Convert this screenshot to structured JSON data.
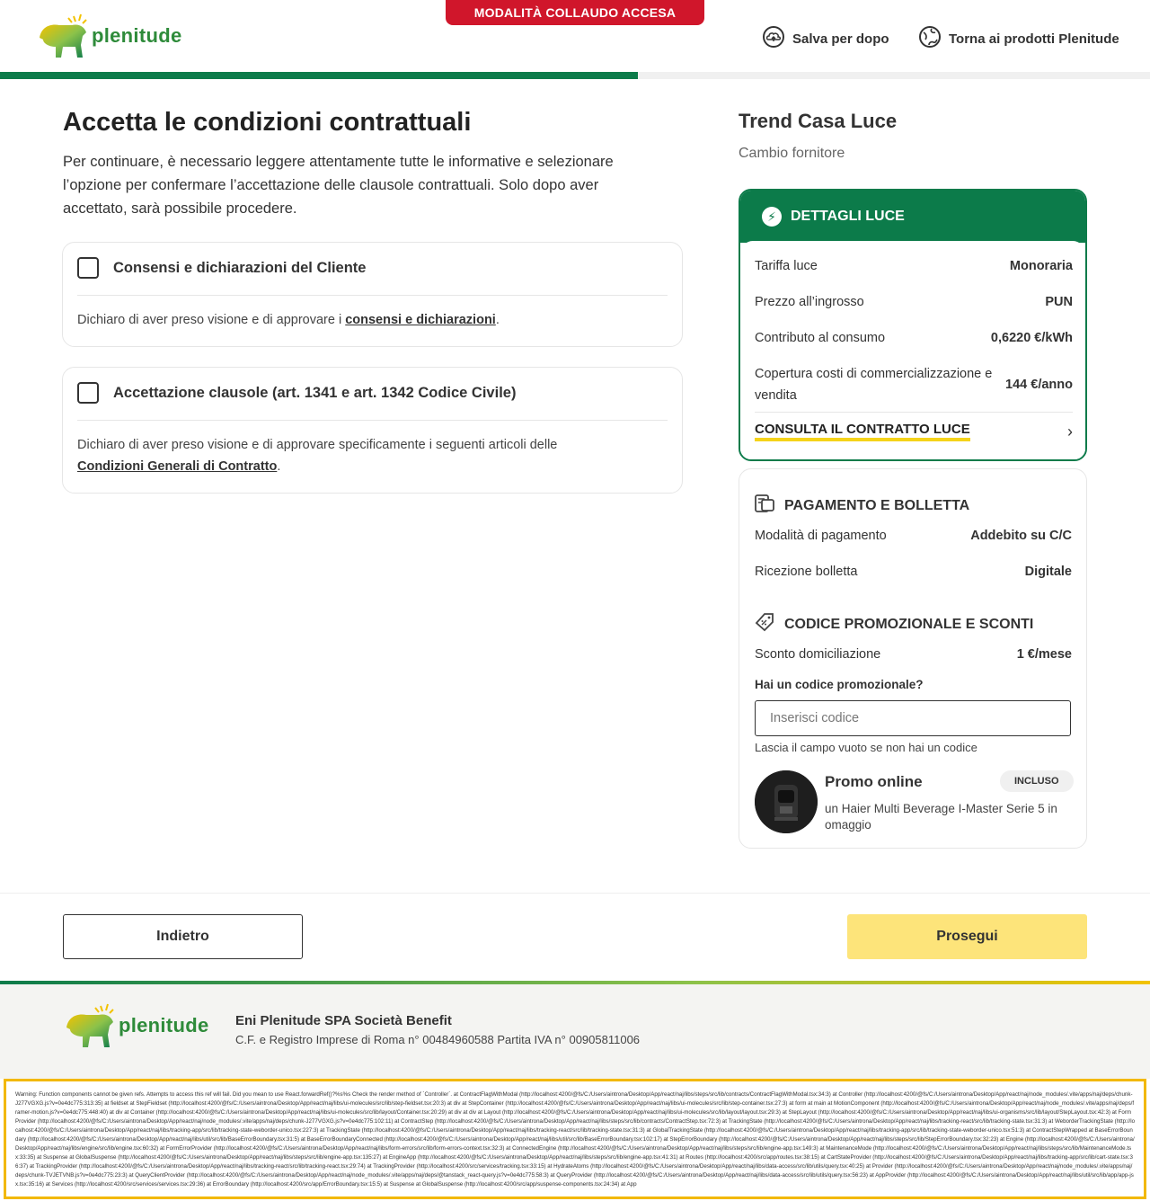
{
  "banner": "MODALITÀ COLLAUDO ACCESA",
  "logo_text": "plenitude",
  "header": {
    "save_label": "Salva per dopo",
    "back_products_label": "Torna ai prodotti Plenitude"
  },
  "progress": 0.555,
  "main": {
    "title": "Accetta le condizioni contrattuali",
    "intro": "Per continuare, è necessario leggere attentamente tutte le informative e selezionare l’opzione per confermare l’accettazione delle clausole contrattuali. Solo dopo aver accettato, sarà possibile procedere.",
    "consents": {
      "title": "Consensi e dichiarazioni del Cliente",
      "desc_prefix": "Dichiaro di aver preso visione e di approvare i ",
      "link": "consensi e dichiarazioni",
      "desc_suffix": "."
    },
    "clauses": {
      "title": "Accettazione clausole (art. 1341 e art. 1342 Codice Civile)",
      "desc_prefix": "Dichiaro di aver preso visione e di approvare specificamente i seguenti articoli delle ",
      "link": "Condizioni Generali di Contratto",
      "desc_suffix": "."
    }
  },
  "summary": {
    "product": "Trend Casa Luce",
    "subtitle": "Cambio fornitore",
    "luce": {
      "title": "DETTAGLI LUCE",
      "rows": [
        {
          "label": "Tariffa luce",
          "value": "Monoraria"
        },
        {
          "label": "Prezzo all’ingrosso",
          "value": "PUN"
        },
        {
          "label": "Contributo al consumo",
          "value": "0,6220 €/kWh"
        },
        {
          "label": "Copertura costi di commercializzazione e vendita",
          "value": "144 €/anno"
        }
      ],
      "contract_link": "CONSULTA IL CONTRATTO LUCE"
    },
    "payment": {
      "title": "PAGAMENTO E BOLLETTA",
      "rows": [
        {
          "label": "Modalità di pagamento",
          "value": "Addebito su C/C"
        },
        {
          "label": "Ricezione bolletta",
          "value": "Digitale"
        }
      ]
    },
    "promo": {
      "title": "CODICE PROMOZIONALE E SCONTI",
      "discount_label": "Sconto domiciliazione",
      "discount_value": "1 €/mese",
      "question": "Hai un codice promozionale?",
      "placeholder": "Inserisci codice",
      "hint": "Lascia il campo vuoto se non hai un codice",
      "offer_title": "Promo online",
      "offer_badge": "INCLUSO",
      "offer_desc": "un Haier Multi Beverage I-Master Serie 5 in omaggio"
    }
  },
  "nav": {
    "back": "Indietro",
    "next": "Prosegui"
  },
  "footer": {
    "company": "Eni Plenitude SPA Società Benefit",
    "registry": "C.F. e Registro Imprese di Roma n° 00484960588 Partita IVA n° 00905811006"
  },
  "error_text": "Warning: Function components cannot be given refs. Attempts to access this ref will fail. Did you mean to use React.forwardRef()?%s%s Check the render method of `Controller`. at ContractFlagWithModal (http://localhost:4200/@fs/C:/Users/aintrona/Desktop/App/react/naj/libs/steps/src/lib/contracts/ContractFlagWithModal.tsx:34:3) at Controller (http://localhost:4200/@fs/C:/Users/aintrona/Desktop/App/react/naj/node_modules/.vite/apps/naj/deps/chunk-J277VGXG.js?v=0e4dc775:313:35) at fieldset at StepFieldset (http://localhost:4200/@fs/C:/Users/aintrona/Desktop/App/react/naj/libs/ui-molecules/src/lib/step-fieldset.tsx:20:3) at div at StepContainer (http://localhost:4200/@fs/C:/Users/aintrona/Desktop/App/react/naj/libs/ui-molecules/src/lib/step-container.tsx:27:3) at form at main at MotionComponent (http://localhost:4200/@fs/C:/Users/aintrona/Desktop/App/react/naj/node_modules/.vite/apps/naj/deps/framer-motion.js?v=0e4dc775:448:40) at div at Container (http://localhost:4200/@fs/C:/Users/aintrona/Desktop/App/react/naj/libs/ui-molecules/src/lib/layout/Container.tsx:20:29) at div at div at Layout (http://localhost:4200/@fs/C:/Users/aintrona/Desktop/App/react/naj/libs/ui-molecules/src/lib/layout/layout.tsx:29:3) at StepLayout (http://localhost:4200/@fs/C:/Users/aintrona/Desktop/App/react/naj/libs/ui-organisms/src/lib/layout/StepLayout.tsx:42:3) at FormProvider (http://localhost:4200/@fs/C:/Users/aintrona/Desktop/App/react/naj/node_modules/.vite/apps/naj/deps/chunk-J277VGXG.js?v=0e4dc775:102:11) at ContractStep (http://localhost:4200/@fs/C:/Users/aintrona/Desktop/App/react/naj/libs/steps/src/lib/contracts/ContractStep.tsx:72:3) at TrackingState (http://localhost:4200/@fs/C:/Users/aintrona/Desktop/App/react/naj/libs/tracking-react/src/lib/tracking-state.tsx:31:3) at WeborderTrackingState (http://localhost:4200/@fs/C:/Users/aintrona/Desktop/App/react/naj/libs/tracking-app/src/lib/tracking-state-weborder-unico.tsx:227:3) at TrackingState (http://localhost:4200/@fs/C:/Users/aintrona/Desktop/App/react/naj/libs/tracking-react/src/lib/tracking-state.tsx:31:3) at GlobalTrackingState (http://localhost:4200/@fs/C:/Users/aintrona/Desktop/App/react/naj/libs/tracking-app/src/lib/tracking-state-weborder-unico.tsx:51:3) at ContractStepWrapped at BaseErrorBoundary (http://localhost:4200/@fs/C:/Users/aintrona/Desktop/App/react/naj/libs/util/src/lib/BaseErrorBoundary.tsx:31:5) at BaseErrorBoundaryConnected (http://localhost:4200/@fs/C:/Users/aintrona/Desktop/App/react/naj/libs/util/src/lib/BaseErrorBoundary.tsx:102:17) at StepErrorBoundary (http://localhost:4200/@fs/C:/Users/aintrona/Desktop/App/react/naj/libs/steps/src/lib/StepErrorBoundary.tsx:32:23) at Engine (http://localhost:4200/@fs/C:/Users/aintrona/Desktop/App/react/naj/libs/engine/src/lib/engine.tsx:60:32) at FormErrorProvider (http://localhost:4200/@fs/C:/Users/aintrona/Desktop/App/react/naj/libs/form-errors/src/lib/form-errors-context.tsx:32:3) at ConnectedEngine (http://localhost:4200/@fs/C:/Users/aintrona/Desktop/App/react/naj/libs/steps/src/lib/engine-app.tsx:149:3) at MaintenanceMode (http://localhost:4200/@fs/C:/Users/aintrona/Desktop/App/react/naj/libs/steps/src/lib/MaintenanceMode.tsx:33:35) at Suspense at GlobalSuspense (http://localhost:4200/@fs/C:/Users/aintrona/Desktop/App/react/naj/libs/steps/src/lib/engine-app.tsx:135:27) at EngineApp (http://localhost:4200/@fs/C:/Users/aintrona/Desktop/App/react/naj/libs/steps/src/lib/engine-app.tsx:41:31) at Routes (http://localhost:4200/src/app/routes.tsx:38:15) at CartStateProvider (http://localhost:4200/@fs/C:/Users/aintrona/Desktop/App/react/naj/libs/tracking-app/src/lib/cart-state.tsx:36:37) at TrackingProvider (http://localhost:4200/@fs/C:/Users/aintrona/Desktop/App/react/naj/libs/tracking-react/src/lib/tracking-react.tsx:29:74) at TrackingProvider (http://localhost:4200/src/services/tracking.tsx:33:15) at HydrateAtoms (http://localhost:4200/@fs/C:/Users/aintrona/Desktop/App/react/naj/libs/data-access/src/lib/utils/query.tsx:40:25) at Provider (http://localhost:4200/@fs/C:/Users/aintrona/Desktop/App/react/naj/node_modules/.vite/apps/naj/deps/chunk-TVJETVNB.js?v=0e4dc775:23:3) at QueryClientProvider (http://localhost:4200/@fs/C:/Users/aintrona/Desktop/App/react/naj/node_modules/.vite/apps/naj/deps/@tanstack_react-query.js?v=0e4dc775:58:3) at QueryProvider (http://localhost:4200/@fs/C:/Users/aintrona/Desktop/App/react/naj/libs/data-access/src/lib/utils/query.tsx:56:23) at AppProvider (http://localhost:4200/@fs/C:/Users/aintrona/Desktop/App/react/naj/libs/util/src/lib/app/app-jsx.tsx:35:16) at Services (http://localhost:4200/src/services/services.tsx:29:36) at ErrorBoundary (http://localhost:4200/src/app/ErrorBoundary.tsx:15:5) at Suspense at GlobalSuspense (http://localhost:4200/src/app/suspense-components.tsx:24:34) at App"
}
